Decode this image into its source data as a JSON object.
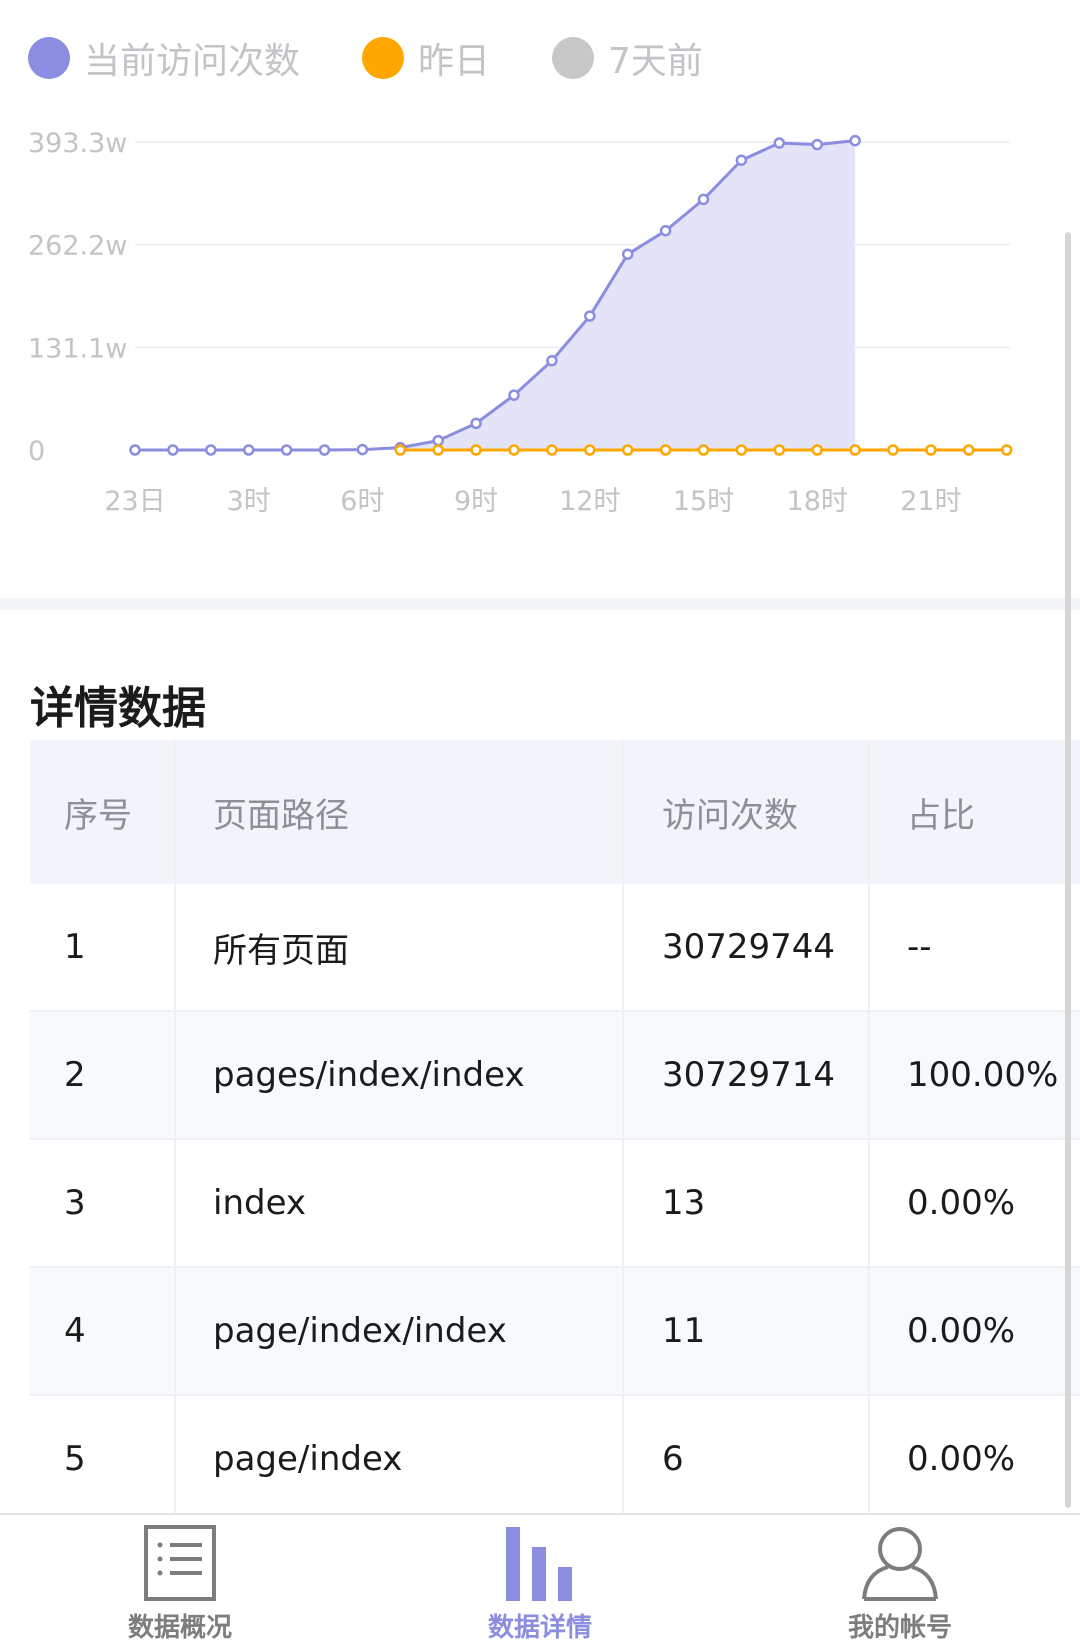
{
  "legend": {
    "items": [
      {
        "label": "当前访问次数",
        "color": "#8b8de0"
      },
      {
        "label": "昨日",
        "color": "#ffa600"
      },
      {
        "label": "7天前",
        "color": "#c8c8c8"
      }
    ]
  },
  "chart_data": {
    "type": "line",
    "x": [
      0,
      1,
      2,
      3,
      4,
      5,
      6,
      7,
      8,
      9,
      10,
      11,
      12,
      13,
      14,
      15,
      16,
      17,
      18,
      19,
      20,
      21,
      22,
      23
    ],
    "x_tick_labels": [
      {
        "x": 0,
        "label": "23日"
      },
      {
        "x": 3,
        "label": "3时"
      },
      {
        "x": 6,
        "label": "6时"
      },
      {
        "x": 9,
        "label": "9时"
      },
      {
        "x": 12,
        "label": "12时"
      },
      {
        "x": 15,
        "label": "15时"
      },
      {
        "x": 18,
        "label": "18时"
      },
      {
        "x": 21,
        "label": "21时"
      }
    ],
    "y_tick_labels": [
      {
        "value": 0,
        "label": "0"
      },
      {
        "value": 131.1,
        "label": "131.1w"
      },
      {
        "value": 262.2,
        "label": "262.2w"
      },
      {
        "value": 393.3,
        "label": "393.3w"
      }
    ],
    "ylim": [
      0,
      393.3
    ],
    "grid": true,
    "legend_position": "top",
    "series": [
      {
        "name": "当前访问次数",
        "color": "#8b8de0",
        "area": true,
        "x": [
          0,
          1,
          2,
          3,
          4,
          5,
          6,
          7,
          8,
          9,
          10,
          11,
          12,
          13,
          14,
          15,
          16,
          17,
          18,
          19
        ],
        "values": [
          0,
          0,
          0,
          0,
          0,
          0,
          0.5,
          3,
          12,
          34,
          70,
          114,
          171,
          250,
          280,
          320,
          370,
          392,
          390,
          395
        ]
      },
      {
        "name": "昨日",
        "color": "#ffa600",
        "area": false,
        "x": [
          7,
          8,
          9,
          10,
          11,
          12,
          13,
          14,
          15,
          16,
          17,
          18,
          19,
          20,
          21,
          22,
          23
        ],
        "values": [
          0,
          0,
          0,
          0,
          0,
          0,
          0,
          0,
          0,
          0,
          0,
          0,
          0,
          0,
          0,
          0,
          0
        ]
      }
    ]
  },
  "detail": {
    "title": "详情数据",
    "columns": [
      "序号",
      "页面路径",
      "访问次数",
      "占比"
    ],
    "rows": [
      [
        "1",
        "所有页面",
        "30729744",
        "--"
      ],
      [
        "2",
        "pages/index/index",
        "30729714",
        "100.00%"
      ],
      [
        "3",
        "index",
        "13",
        "0.00%"
      ],
      [
        "4",
        "page/index/index",
        "11",
        "0.00%"
      ],
      [
        "5",
        "page/index",
        "6",
        "0.00%"
      ]
    ]
  },
  "tabbar": {
    "items": [
      {
        "label": "数据概况",
        "icon": "list-doc-icon",
        "active": false
      },
      {
        "label": "数据详情",
        "icon": "bar-chart-icon",
        "active": true
      },
      {
        "label": "我的帐号",
        "icon": "user-icon",
        "active": false
      }
    ],
    "active_color": "#8b8de0",
    "inactive_color": "#7d7d7d"
  }
}
